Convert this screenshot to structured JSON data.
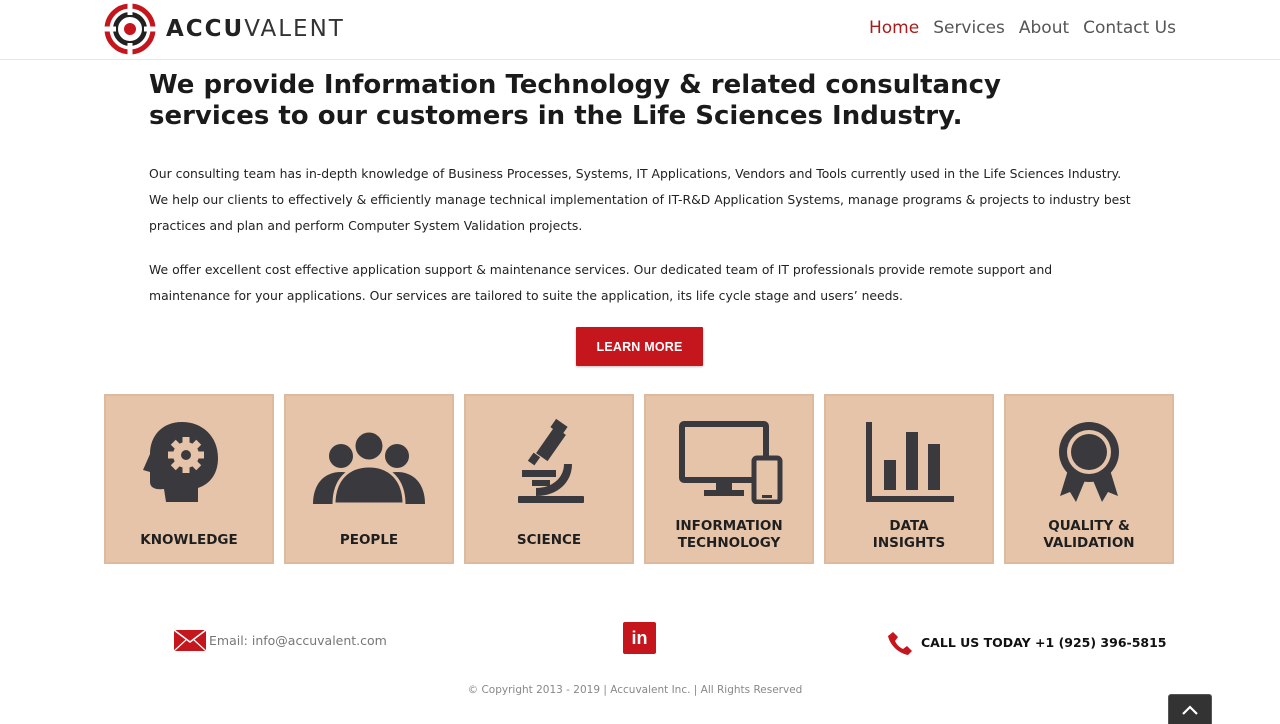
{
  "header": {
    "logo_bold": "ACCU",
    "logo_light": "VALENT",
    "nav": [
      {
        "label": "Home",
        "active": true
      },
      {
        "label": "Services",
        "active": false
      },
      {
        "label": "About",
        "active": false
      },
      {
        "label": "Contact Us",
        "active": false
      }
    ]
  },
  "main": {
    "headline": "We provide Information Technology & related consultancy services to our customers in the Life Sciences Industry.",
    "paragraph1": "Our consulting team has in-depth knowledge of Business Processes, Systems, IT Applications, Vendors and Tools currently used in the Life  Sciences Industry. We help our clients to effectively & efficiently manage technical implementation of IT-R&D Application Systems, manage programs & projects to industry best practices and plan and perform Computer System Validation projects.",
    "paragraph2": "We offer excellent cost effective application support & maintenance services. Our dedicated team of IT professionals provide remote support and maintenance for your applications. Our services are tailored to suite the application, its life cycle stage and users’ needs.",
    "learn_more": "LEARN MORE"
  },
  "tiles": [
    {
      "line1": "KNOWLEDGE",
      "line2": "",
      "icon": "head-gear-icon"
    },
    {
      "line1": "PEOPLE",
      "line2": "",
      "icon": "people-icon"
    },
    {
      "line1": "SCIENCE",
      "line2": "",
      "icon": "microscope-icon"
    },
    {
      "line1": "INFORMATION",
      "line2": "TECHNOLOGY",
      "icon": "monitor-phone-icon"
    },
    {
      "line1": "DATA",
      "line2": "INSIGHTS",
      "icon": "bar-chart-icon"
    },
    {
      "line1": "QUALITY &",
      "line2": "VALIDATION",
      "icon": "award-ribbon-icon"
    }
  ],
  "footer": {
    "email": "Email: info@accuvalent.com",
    "linkedin": "in",
    "call": "CALL US TODAY +1 (925) 396-5815",
    "copyright": "© Copyright 2013 - 2019   |   Accuvalent Inc.   |   All Rights Reserved"
  },
  "colors": {
    "brand_red": "#c4161c",
    "nav_active": "#a81c1c",
    "tile_bg": "#e6c4aa",
    "icon_dark": "#3a3a3e"
  }
}
